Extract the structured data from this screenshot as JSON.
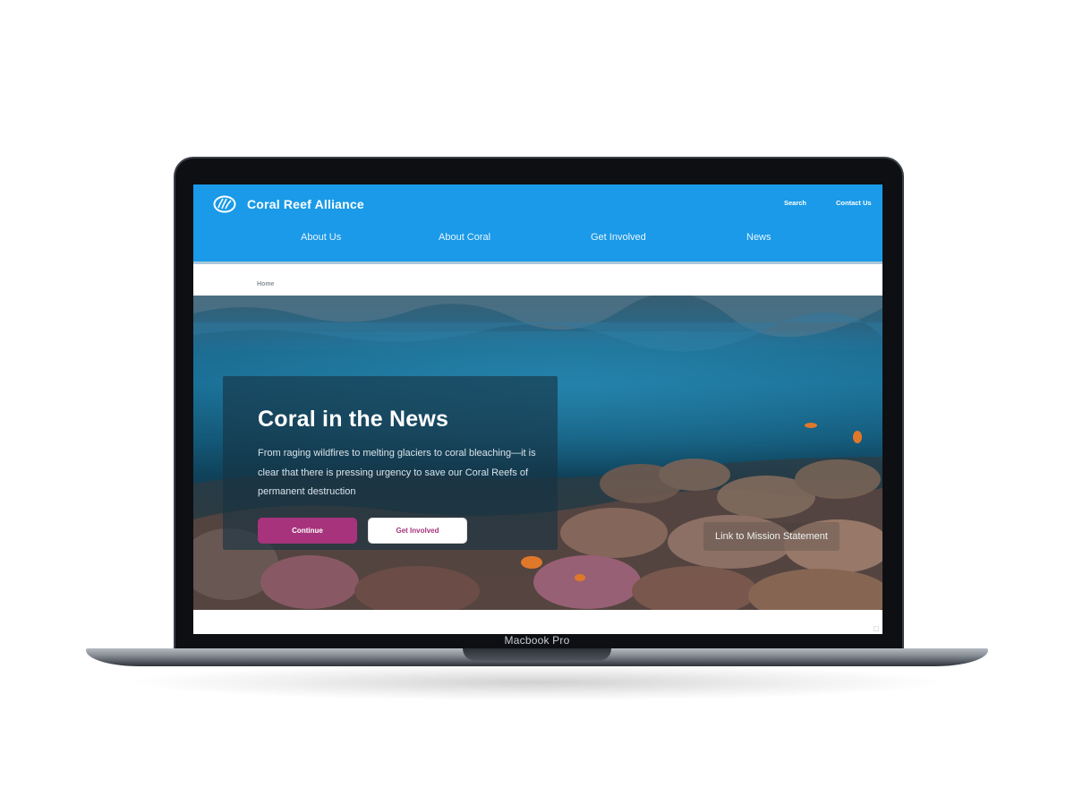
{
  "device": {
    "label": "Macbook Pro"
  },
  "site": {
    "brand": "Coral Reef Alliance",
    "utility_nav": {
      "search": "Search",
      "contact": "Contact Us"
    },
    "main_nav": [
      "About Us",
      "About Coral",
      "Get Involved",
      "News"
    ],
    "breadcrumb": "Home"
  },
  "hero": {
    "title": "Coral in the News",
    "body": "From raging wildfires to melting glaciers to coral bleaching—it is clear that there is pressing urgency to save our Coral Reefs of permanent destruction",
    "primary_button": "Continue",
    "secondary_button": "Get Involved",
    "mission_link": "Link to Mission Statement"
  },
  "colors": {
    "header_blue": "#1a9ae8",
    "accent_magenta": "#a6337b",
    "laptop_bezel": "#0d0f12"
  }
}
